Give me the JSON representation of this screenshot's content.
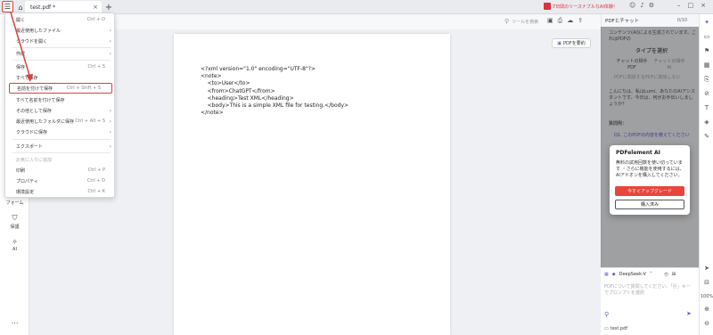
{
  "titlebar": {
    "tab_title": "test.pdf *",
    "promo": "7日間のリースナブルなAI体験！"
  },
  "toolbar": {
    "search_placeholder": "ツールを検索"
  },
  "leftbar": {
    "form": "フォーム",
    "protect": "保護",
    "ai": "AI"
  },
  "canvas": {
    "summarize_button": "PDFを要約",
    "xml_lines": [
      "<?xml version=\"1.0\" encoding=\"UTF-8\"?>",
      "<note>",
      "    <to>User</to>",
      "    <from>ChatGPT</from>",
      "    <heading>Test XML</heading>",
      "    <body>This is a simple XML file for testing.</body>",
      "</note>"
    ]
  },
  "menu": {
    "items": [
      {
        "label": "開く",
        "shortcut": "Ctrl + O"
      },
      {
        "label": "最近使用したファイル",
        "arrow": true
      },
      {
        "label": "クラウドを開く",
        "arrow": true
      },
      {
        "label": "作成",
        "arrow": true
      },
      {
        "label": "保存",
        "shortcut": "Ctrl + S"
      },
      {
        "label": "すべて保存"
      },
      {
        "label": "名前を付けて保存",
        "shortcut": "Ctrl + Shift + S"
      },
      {
        "label": "すべて名前を付けて保存"
      },
      {
        "label": "その他として保存",
        "arrow": true
      },
      {
        "label": "最近使用したフォルダに保存",
        "shortcut": "Ctrl + Alt + S",
        "arrow": true
      },
      {
        "label": "クラウドに保存",
        "arrow": true
      },
      {
        "label": "エクスポート",
        "arrow": true
      },
      {
        "label": "お気に入りに追加",
        "disabled": true
      },
      {
        "label": "印刷",
        "shortcut": "Ctrl + P"
      },
      {
        "label": "プロパティ",
        "shortcut": "Ctrl + D"
      },
      {
        "label": "環境設定",
        "shortcut": "Ctrl + K"
      }
    ]
  },
  "panel": {
    "header": "PDFとチャット",
    "counter": "0/10",
    "intro": "コンテンツ(AI)による生成されています。これはPDFの",
    "choose_type": "タイプを選択",
    "tab_chat_pdf": "チャットの相手",
    "tab_chat_pdf_sub": "PDF",
    "tab_chat_ai": "チャットの相手",
    "tab_chat_ai_sub": "AI",
    "scope": "PDFに関係するPDFに関係しない",
    "greeting": "こんにちは、私はLumi、あなたのAIアシスタントです。今日は、何がお手伝いしましょうか？",
    "question_label": "質問例：",
    "question": "Q1. このPDFの内容を教えてください",
    "model": "DeepSeek-V",
    "input_placeholder": "PDFについて質問してください。「＠」キーでプロンプトを選択",
    "file": "test.pdf"
  },
  "modal": {
    "title": "PDFelement AI",
    "description": "無料の試用回数を使い切っています ・さらに機能を使用するには、AIアドオンを購入してください。",
    "upgrade": "今すぐアップグレード",
    "purchased": "購入済み"
  },
  "rightbar": {
    "zoom": "100%",
    "page": "1"
  }
}
